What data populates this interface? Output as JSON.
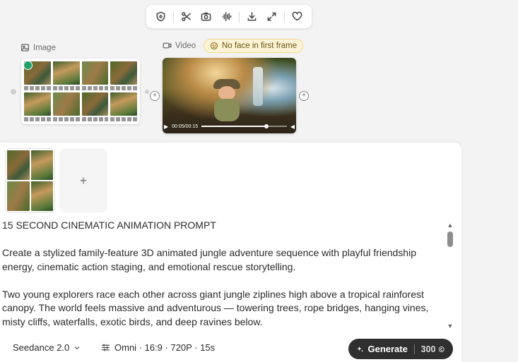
{
  "toolbar": {
    "icons": [
      "shield-icon",
      "scissors-icon",
      "camera-icon",
      "waveform-icon",
      "download-icon",
      "expand-icon",
      "heart-icon"
    ]
  },
  "image_node": {
    "label": "Image"
  },
  "video_node": {
    "label": "Video",
    "badge": "No face in first frame",
    "time": "00:05/00:15",
    "progress": 0.76
  },
  "prompt": {
    "heading": "15 SECOND CINEMATIC ANIMATION PROMPT",
    "paragraph1": "Create a stylized family-feature 3D animated jungle adventure sequence with playful friendship energy, cinematic action staging, and emotional rescue storytelling.",
    "paragraph2": "Two young explorers race each other across giant jungle ziplines high above a tropical rainforest canopy. The world feels massive and adventurous — towering trees, rope bridges, hanging vines, misty cliffs, waterfalls, exotic birds, and deep ravines below."
  },
  "bottom_bar": {
    "model": "Seedance 2.0",
    "settings": "Omni · 16:9 · 720P · 15s",
    "generate_label": "Generate",
    "cost": "300"
  },
  "colors": {
    "badge_bg": "#fdf3d6",
    "generate_bg": "#2f2f30",
    "accent_green": "#21a06a"
  }
}
